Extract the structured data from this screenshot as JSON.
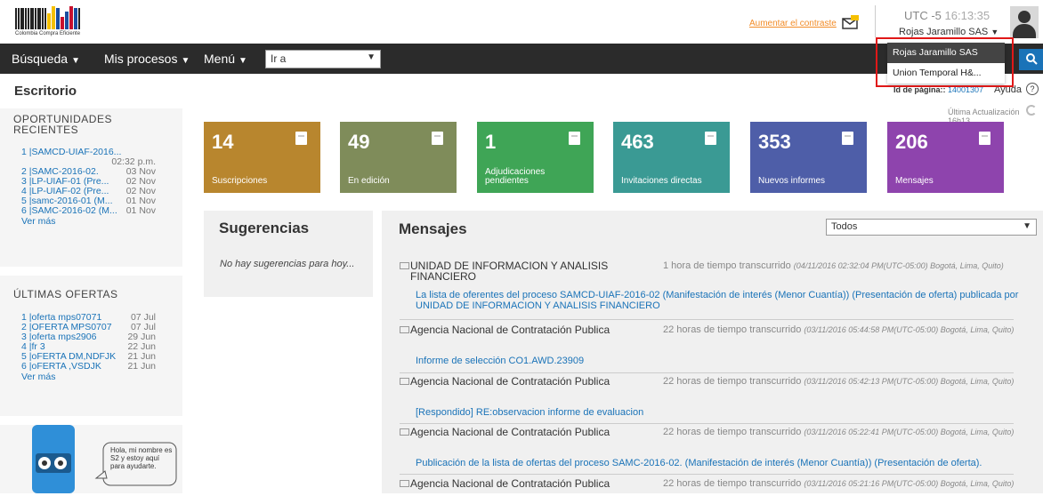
{
  "header": {
    "logo_caption": "Colombia Compra Eficiente",
    "contrast_link": "Aumentar el contraste",
    "utc_label": "UTC -5",
    "time": "16:13:35",
    "user": "Rojas Jaramillo SAS"
  },
  "nav": {
    "items": [
      "Búsqueda",
      "Mis procesos",
      "Menú"
    ],
    "goto_value": "Ir a"
  },
  "page": {
    "title": "Escritorio",
    "page_id_label": "Id de página::",
    "page_id": "14001307",
    "help": "Ayuda",
    "last_update": "Última Actualización 16h13"
  },
  "account_menu": {
    "options": [
      "Rojas Jaramillo SAS",
      "Union Temporal H&..."
    ]
  },
  "sidebar": {
    "opportunities": {
      "title": "OPORTUNIDADES RECIENTES",
      "items": [
        {
          "label": "1 |SAMCD-UIAF-2016...",
          "date": "02:32 p.m."
        },
        {
          "label": "2 |SAMC-2016-02.",
          "date": "03 Nov"
        },
        {
          "label": "3 |LP-UIAF-01 (Pre...",
          "date": "02 Nov"
        },
        {
          "label": "4 |LP-UIAF-02 (Pre...",
          "date": "02 Nov"
        },
        {
          "label": "5 |samc-2016-01 (M...",
          "date": "01 Nov"
        },
        {
          "label": "6 |SAMC-2016-02 (M...",
          "date": "01 Nov"
        }
      ],
      "more": "Ver más"
    },
    "offers": {
      "title": "ÚLTIMAS OFERTAS",
      "items": [
        {
          "label": "1 |oferta mps07071",
          "date": "07 Jul"
        },
        {
          "label": "2 |OFERTA MPS0707",
          "date": "07 Jul"
        },
        {
          "label": "3 |oferta mps2906",
          "date": "29 Jun"
        },
        {
          "label": "4 |fr 3",
          "date": "22 Jun"
        },
        {
          "label": "5 |oFERTA DM,NDFJK",
          "date": "21 Jun"
        },
        {
          "label": "6 |oFERTA ,VSDJK",
          "date": "21 Jun"
        }
      ],
      "more": "Ver más"
    },
    "bot_text": "Hola, mi nombre es S2 y estoy aquí para ayudarte."
  },
  "tiles": [
    {
      "num": "14",
      "label": "Suscripciones",
      "color": "#b8862e"
    },
    {
      "num": "49",
      "label": "En edición",
      "color": "#7f8c5a"
    },
    {
      "num": "1",
      "label": "Adjudicaciones pendientes",
      "color": "#3fa556"
    },
    {
      "num": "463",
      "label": "Invitaciones directas",
      "color": "#3a9a94"
    },
    {
      "num": "353",
      "label": "Nuevos informes",
      "color": "#4e5ea8"
    },
    {
      "num": "206",
      "label": "Mensajes",
      "color": "#8e44ad"
    }
  ],
  "suggestions": {
    "title": "Sugerencias",
    "empty": "No hay sugerencias para hoy..."
  },
  "messages": {
    "title": "Mensajes",
    "filter": "Todos",
    "items": [
      {
        "from": "UNIDAD DE INFORMACION Y ANALISIS FINANCIERO",
        "ago": "1 hora de tiempo transcurrido",
        "stamp": "(04/11/2016 02:32:04 PM(UTC-05:00) Bogotá, Lima, Quito)",
        "subject": "La lista de oferentes del proceso SAMCD-UIAF-2016-02 (Manifestación de interés (Menor Cuantía)) (Presentación de oferta) publicada por UNIDAD DE INFORMACION Y ANALISIS FINANCIERO"
      },
      {
        "from": "Agencia Nacional de Contratación Publica",
        "ago": "22 horas de tiempo transcurrido",
        "stamp": "(03/11/2016 05:44:58 PM(UTC-05:00) Bogotá, Lima, Quito)",
        "subject": "Informe de selección CO1.AWD.23909"
      },
      {
        "from": "Agencia Nacional de Contratación Publica",
        "ago": "22 horas de tiempo transcurrido",
        "stamp": "(03/11/2016 05:42:13 PM(UTC-05:00) Bogotá, Lima, Quito)",
        "subject": "[Respondido] RE:observacion informe de evaluacion"
      },
      {
        "from": "Agencia Nacional de Contratación Publica",
        "ago": "22 horas de tiempo transcurrido",
        "stamp": "(03/11/2016 05:22:41 PM(UTC-05:00) Bogotá, Lima, Quito)",
        "subject": "Publicación de la lista de ofertas del proceso SAMC-2016-02. (Manifestación de interés (Menor Cuantía)) (Presentación de oferta)."
      },
      {
        "from": "Agencia Nacional de Contratación Publica",
        "ago": "22 horas de tiempo transcurrido",
        "stamp": "(03/11/2016 05:21:16 PM(UTC-05:00) Bogotá, Lima, Quito)",
        "subject": ""
      }
    ]
  }
}
